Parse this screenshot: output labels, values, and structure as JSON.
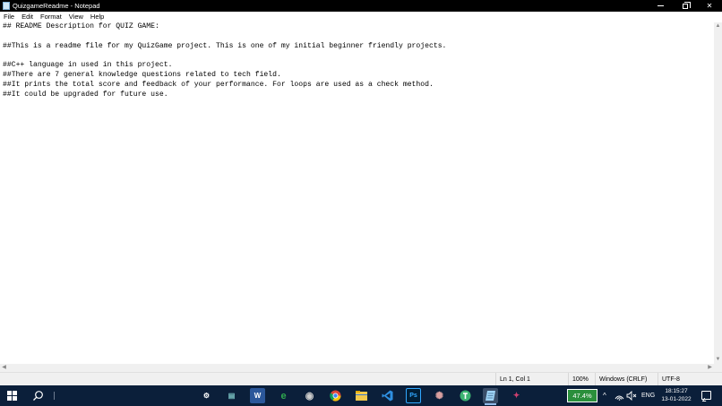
{
  "window": {
    "title": "QuizgameReadme - Notepad",
    "min_symbol": "",
    "max_symbol": "",
    "close_symbol": "✕"
  },
  "menu": [
    "File",
    "Edit",
    "Format",
    "View",
    "Help"
  ],
  "editor": {
    "lines": [
      "## README Description for QUIZ GAME:",
      "",
      "##This is a readme file for my QuizGame project. This is one of my initial beginner friendly projects.",
      "",
      "##C++ language in used in this project.",
      "##There are 7 general knowledge questions related to tech field.",
      "##It prints the total score and feedback of your performance. For loops are used as a check method.",
      "##It could be upgraded for future use."
    ]
  },
  "status": {
    "position": "Ln 1, Col 1",
    "zoom": "100%",
    "line_endings": "Windows (CRLF)",
    "encoding": "UTF-8"
  },
  "taskbar": {
    "apps": [
      {
        "name": "settings",
        "glyph": "⚙",
        "color": "#ffffff"
      },
      {
        "name": "terminal",
        "glyph": "▤",
        "color": "#7ec8c8"
      },
      {
        "name": "word",
        "glyph": "W",
        "color": "#2b579a"
      },
      {
        "name": "edge",
        "glyph": "e",
        "color": "#2fa84f"
      },
      {
        "name": "media",
        "glyph": "◉",
        "color": "#cccccc"
      },
      {
        "name": "chrome",
        "glyph": "●",
        "color": "#e8b83a"
      },
      {
        "name": "file-explorer",
        "glyph": "▬",
        "color": "#f2c94c"
      },
      {
        "name": "vscode",
        "glyph": "❮❯",
        "color": "#2f8fe0"
      },
      {
        "name": "photoshop",
        "glyph": "Ps",
        "color": "#31a8ff"
      },
      {
        "name": "gear-app",
        "glyph": "✺",
        "color": "#d9a0a0"
      },
      {
        "name": "green-app",
        "glyph": "✚",
        "color": "#3cb371"
      },
      {
        "name": "notepad",
        "glyph": "▱",
        "color": "#9fd3f5"
      },
      {
        "name": "davinci",
        "glyph": "✦",
        "color": "#d04070"
      }
    ],
    "battery": "47.4%",
    "language": "ENG",
    "time": "18:15:27",
    "date": "13-01-2022"
  }
}
